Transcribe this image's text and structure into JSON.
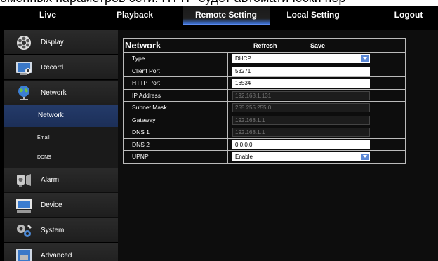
{
  "caption": "оменных параметров сети. НТТР будет автоматически пер",
  "topnav": {
    "tabs": [
      {
        "label": "Live"
      },
      {
        "label": "Playback"
      },
      {
        "label": "Remote Setting"
      },
      {
        "label": "Local Setting"
      },
      {
        "label": "Logout"
      }
    ],
    "active": "Remote Setting"
  },
  "sidebar": {
    "items": [
      {
        "label": "Display",
        "icon": "film-reel-icon"
      },
      {
        "label": "Record",
        "icon": "monitor-record-icon"
      },
      {
        "label": "Network",
        "icon": "globe-network-icon"
      },
      {
        "label": "Network",
        "sub": true,
        "active": true
      },
      {
        "label": "Email",
        "sub": true
      },
      {
        "label": "DDNS",
        "sub": true
      },
      {
        "label": "Alarm",
        "icon": "alarm-siren-icon"
      },
      {
        "label": "Device",
        "icon": "device-drive-icon"
      },
      {
        "label": "System",
        "icon": "gears-icon"
      },
      {
        "label": "Advanced",
        "icon": "advanced-tools-icon"
      }
    ]
  },
  "network": {
    "title": "Network",
    "refresh_label": "Refresh",
    "save_label": "Save",
    "fields": [
      {
        "label": "Type",
        "value": "DHCP",
        "kind": "select"
      },
      {
        "label": "Client Port",
        "value": "53271",
        "kind": "edit"
      },
      {
        "label": "HTTP Port",
        "value": "16534",
        "kind": "edit"
      },
      {
        "label": "IP Address",
        "value": "192.168.1.131",
        "kind": "disabled"
      },
      {
        "label": "Subnet Mask",
        "value": "255.255.255.0",
        "kind": "disabled"
      },
      {
        "label": "Gateway",
        "value": "192.168.1.1",
        "kind": "disabled"
      },
      {
        "label": "DNS 1",
        "value": "192.168.1.1",
        "kind": "disabled"
      },
      {
        "label": "DNS 2",
        "value": "0.0.0.0",
        "kind": "edit"
      },
      {
        "label": "UPNP",
        "value": "Enable",
        "kind": "select"
      }
    ]
  },
  "colors": {
    "active_tab_accent": "#4a7fe0",
    "active_sub_bg": "#243b6a",
    "dropdown_arrow": "#5b88d6"
  }
}
